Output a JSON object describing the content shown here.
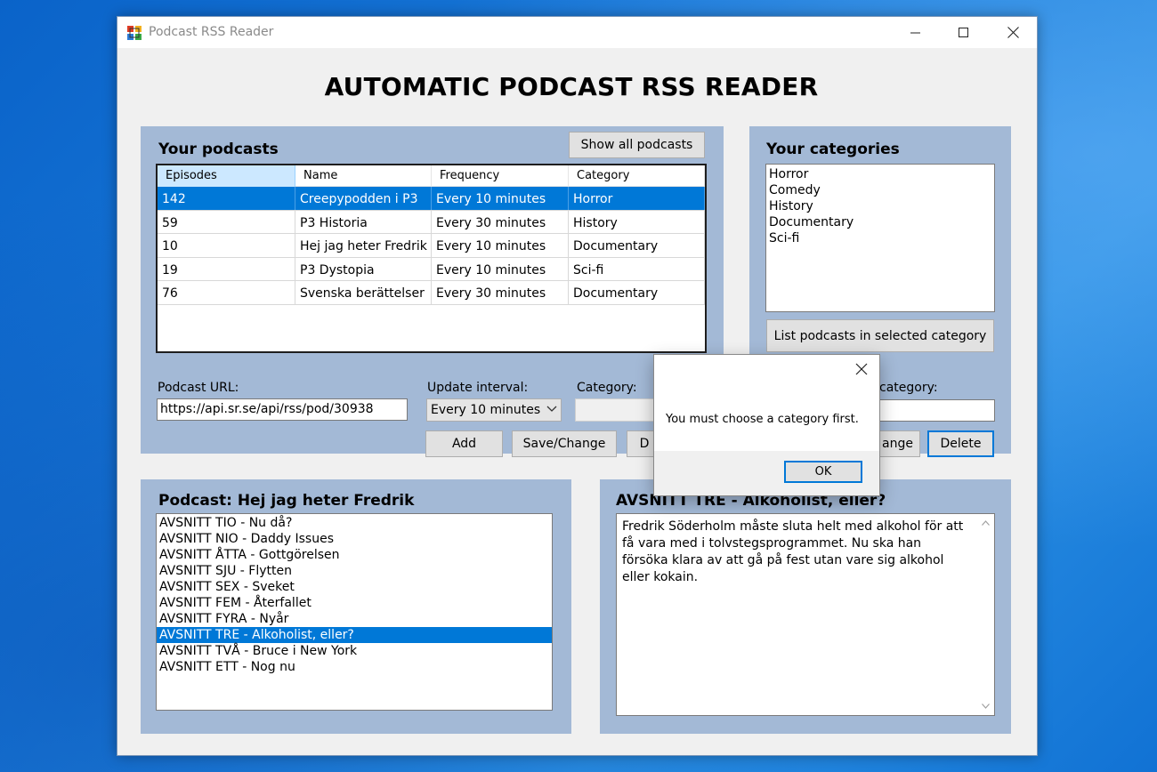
{
  "window": {
    "title": "Podcast RSS Reader"
  },
  "heading": "AUTOMATIC PODCAST RSS READER",
  "podcasts_panel": {
    "title": "Your podcasts",
    "show_all_label": "Show all podcasts",
    "columns": [
      "Episodes",
      "Name",
      "Frequency",
      "Category"
    ],
    "rows": [
      {
        "episodes": "142",
        "name": "Creepypodden i P3",
        "frequency": "Every 10 minutes",
        "category": "Horror",
        "selected": true
      },
      {
        "episodes": "59",
        "name": "P3 Historia",
        "frequency": "Every 30 minutes",
        "category": "History",
        "selected": false
      },
      {
        "episodes": "10",
        "name": "Hej jag heter Fredrik",
        "frequency": "Every 10 minutes",
        "category": "Documentary",
        "selected": false
      },
      {
        "episodes": "19",
        "name": "P3 Dystopia",
        "frequency": "Every 10 minutes",
        "category": "Sci-fi",
        "selected": false
      },
      {
        "episodes": "76",
        "name": "Svenska berättelser",
        "frequency": "Every 30 minutes",
        "category": "Documentary",
        "selected": false
      }
    ],
    "url_label": "Podcast URL:",
    "url_value": "https://api.sr.se/api/rss/pod/30938",
    "interval_label": "Update interval:",
    "interval_value": "Every 10 minutes",
    "category_label": "Category:",
    "category_value": "",
    "add_label": "Add",
    "save_label": "Save/Change",
    "delete_label_visible": "D"
  },
  "categories_panel": {
    "title": "Your categories",
    "items": [
      "Horror",
      "Comedy",
      "History",
      "Documentary",
      "Sci-fi"
    ],
    "list_button_label": "List podcasts in selected category",
    "new_category_label_visible": "category:",
    "new_category_value": "",
    "change_label_visible": "ange",
    "delete_label": "Delete"
  },
  "episodes_panel": {
    "title": "Podcast: Hej jag heter Fredrik",
    "episodes": [
      "AVSNITT TIO - Nu då?",
      "AVSNITT NIO - Daddy Issues",
      "AVSNITT ÅTTA - Gottgörelsen",
      "AVSNITT SJU - Flytten",
      "AVSNITT SEX - Sveket",
      "AVSNITT FEM - Återfallet",
      "AVSNITT FYRA - Nyår",
      "AVSNITT TRE - Alkoholist, eller?",
      "AVSNITT TVÅ - Bruce i New York",
      "AVSNITT ETT - Nog nu"
    ],
    "selected_index": 7
  },
  "description_panel": {
    "title": "AVSNITT TRE - Alkoholist, eller?",
    "text": "Fredrik Söderholm måste sluta helt med alkohol för att få vara med i tolvstegsprogrammet. Nu ska han försöka klara av att gå på fest utan vare sig alkohol eller kokain."
  },
  "dialog": {
    "message": "You must choose a category first.",
    "ok_label": "OK"
  },
  "colors": {
    "panel_bg": "#a3b9d6",
    "selection": "#0078d7",
    "window_bg": "#f0f0f0",
    "focus_border": "#0078d7"
  }
}
